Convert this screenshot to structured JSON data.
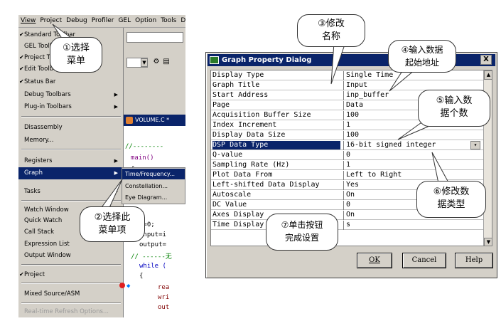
{
  "menubar": {
    "items": [
      "View",
      "Project",
      "Debug",
      "Profiler",
      "GEL",
      "Option",
      "Tools",
      "DSP"
    ]
  },
  "view_menu": {
    "items": [
      {
        "label": "Standard Toolbar",
        "checked": true
      },
      {
        "label": "GEL Toolbar",
        "checked": false
      },
      {
        "label": "Project Toolbar",
        "checked": true
      },
      {
        "label": "Edit Toolbar",
        "checked": true
      },
      {
        "label": "Status Bar",
        "checked": true
      },
      {
        "label": "Debug Toolbars",
        "submenu": true
      },
      {
        "label": "Plug-in Toolbars",
        "submenu": true
      },
      {
        "label": "Disassembly"
      },
      {
        "label": "Memory..."
      },
      {
        "label": "Registers",
        "submenu": true
      },
      {
        "label": "Graph",
        "submenu": true,
        "selected": true
      },
      {
        "label": "Tasks",
        "submenu": true
      },
      {
        "label": "Watch Window"
      },
      {
        "label": "Quick Watch"
      },
      {
        "label": "Call Stack"
      },
      {
        "label": "Expression List"
      },
      {
        "label": "Output Window"
      },
      {
        "label": "Project",
        "checked": true
      },
      {
        "label": "Mixed Source/ASM"
      },
      {
        "label": "Real-time Refresh Options...",
        "disabled": true
      }
    ]
  },
  "graph_submenu": {
    "items": [
      "Time/Frequency...",
      "Constellation...",
      "Eye Diagram..."
    ]
  },
  "editor": {
    "title": "VOLUME.C *",
    "lines": [
      "//--------",
      "main()",
      "{",
      "i=0;",
      "input=i",
      "output=",
      "// ------无",
      "while (",
      "{",
      "rea",
      "wri",
      "out"
    ]
  },
  "annotations": {
    "a1": "①选择\n菜单",
    "a2": "②选择此\n菜单项",
    "a3": "③修改\n名称",
    "a4": "④输入数据\n起始地址",
    "a5": "⑤输入数\n据个数",
    "a6": "⑥修改数\n据类型",
    "a7": "⑦单击按钮\n完成设置"
  },
  "dialog": {
    "title": "Graph Property Dialog",
    "close_label": "X",
    "rows": [
      {
        "key": "Display Type",
        "value": "Single Time"
      },
      {
        "key": "Graph Title",
        "value": "Input"
      },
      {
        "key": "Start Address",
        "value": "inp_buffer"
      },
      {
        "key": "Page",
        "value": "Data"
      },
      {
        "key": "Acquisition Buffer Size",
        "value": "100"
      },
      {
        "key": "Index Increment",
        "value": "1"
      },
      {
        "key": "Display Data Size",
        "value": "100"
      },
      {
        "key": "DSP Data Type",
        "value": "16-bit signed integer",
        "selected": true
      },
      {
        "key": "Q-value",
        "value": "0"
      },
      {
        "key": "Sampling Rate (Hz)",
        "value": "1"
      },
      {
        "key": "Plot Data From",
        "value": "Left to Right"
      },
      {
        "key": "Left-shifted Data Display",
        "value": "Yes"
      },
      {
        "key": "Autoscale",
        "value": "On"
      },
      {
        "key": "DC Value",
        "value": "0"
      },
      {
        "key": "Axes Display",
        "value": "On"
      },
      {
        "key": "Time Display Unit",
        "value": "s"
      }
    ],
    "buttons": {
      "ok": "OK",
      "cancel": "Cancel",
      "help": "Help"
    }
  }
}
